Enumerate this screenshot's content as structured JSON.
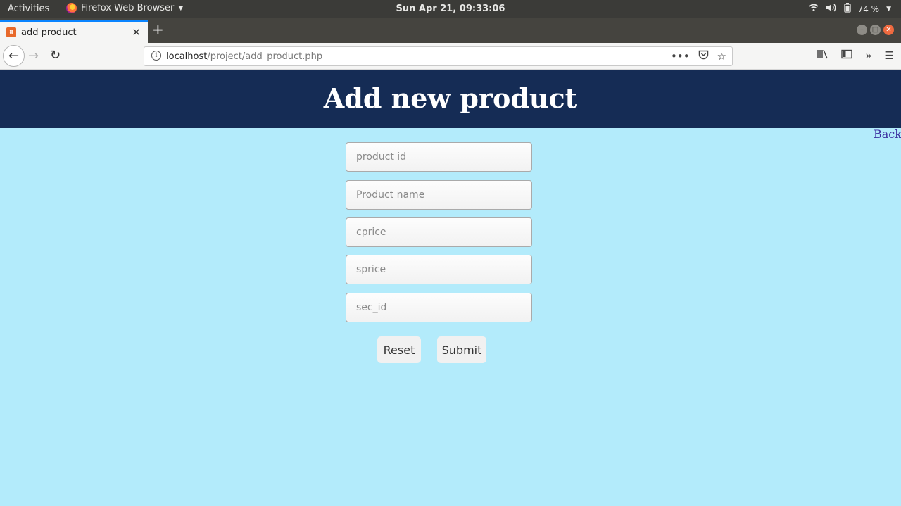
{
  "system": {
    "activities": "Activities",
    "app_menu": "Firefox Web Browser",
    "clock": "Sun Apr 21, 09:33:06",
    "battery": "74 %"
  },
  "browser": {
    "tab_title": "add product",
    "url_host": "localhost",
    "url_path": "/project/add_product.php"
  },
  "page": {
    "heading": "Add new product",
    "back_link": "Back",
    "fields": [
      {
        "placeholder": "product id"
      },
      {
        "placeholder": "Product name"
      },
      {
        "placeholder": "cprice"
      },
      {
        "placeholder": "sprice"
      },
      {
        "placeholder": "sec_id"
      }
    ],
    "reset_label": "Reset",
    "submit_label": "Submit"
  },
  "colors": {
    "header_bg": "#152c55",
    "page_bg": "#b3ebfb",
    "link": "#3c2fa0"
  }
}
